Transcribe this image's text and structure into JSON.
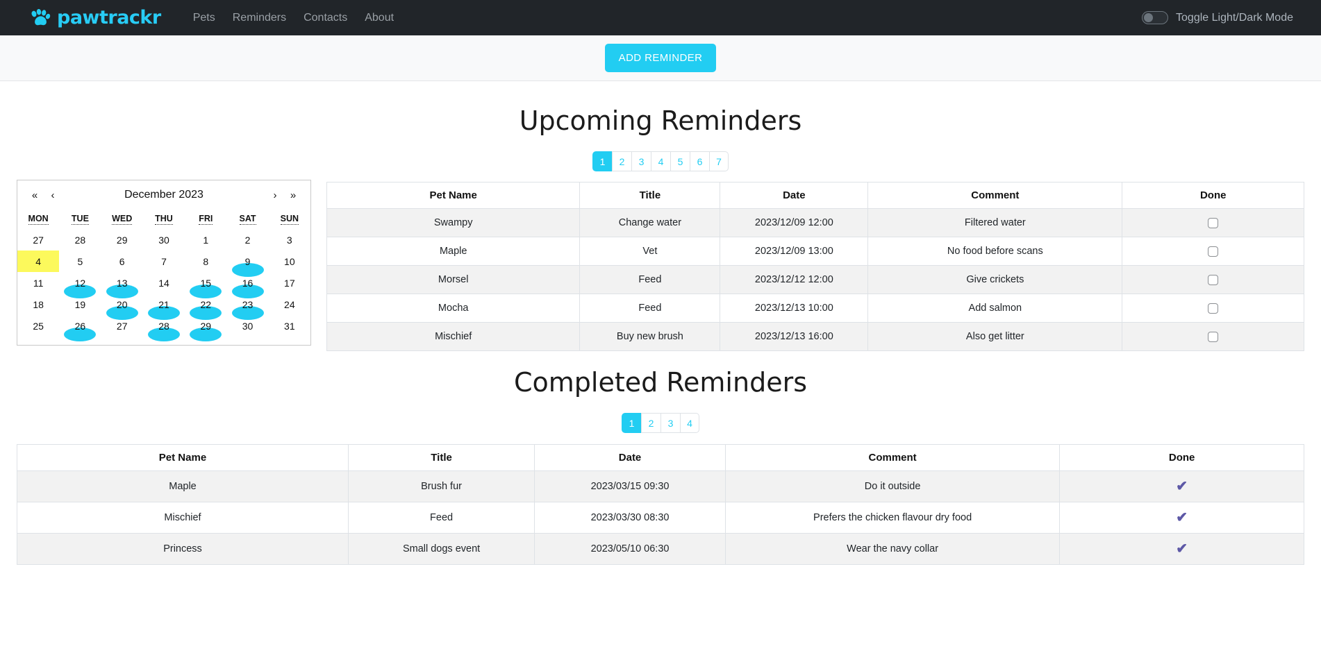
{
  "navbar": {
    "brand": "pawtrackr",
    "brand_icon": "paw-icon",
    "links": [
      {
        "label": "Pets"
      },
      {
        "label": "Reminders"
      },
      {
        "label": "Contacts"
      },
      {
        "label": "About"
      }
    ],
    "theme_toggle_label": "Toggle Light/Dark Mode",
    "theme_toggle_state": "off",
    "accent_color": "#22cdf2",
    "background_color": "#212529"
  },
  "actionbar": {
    "add_reminder_label": "ADD REMINDER"
  },
  "upcoming": {
    "title": "Upcoming Reminders",
    "pagination": {
      "pages": [
        "1",
        "2",
        "3",
        "4",
        "5",
        "6",
        "7"
      ],
      "active": "1"
    },
    "columns": [
      "Pet Name",
      "Title",
      "Date",
      "Comment",
      "Done"
    ],
    "rows": [
      {
        "pet": "Swampy",
        "title": "Change water",
        "date": "2023/12/09 12:00",
        "comment": "Filtered water",
        "done": false
      },
      {
        "pet": "Maple",
        "title": "Vet",
        "date": "2023/12/09 13:00",
        "comment": "No food before scans",
        "done": false
      },
      {
        "pet": "Morsel",
        "title": "Feed",
        "date": "2023/12/12 12:00",
        "comment": "Give crickets",
        "done": false
      },
      {
        "pet": "Mocha",
        "title": "Feed",
        "date": "2023/12/13 10:00",
        "comment": "Add salmon",
        "done": false
      },
      {
        "pet": "Mischief",
        "title": "Buy new brush",
        "date": "2023/12/13 16:00",
        "comment": "Also get litter",
        "done": false
      }
    ]
  },
  "completed": {
    "title": "Completed Reminders",
    "pagination": {
      "pages": [
        "1",
        "2",
        "3",
        "4"
      ],
      "active": "1"
    },
    "columns": [
      "Pet Name",
      "Title",
      "Date",
      "Comment",
      "Done"
    ],
    "done_glyph": "✔",
    "done_color": "#5d58a6",
    "rows": [
      {
        "pet": "Maple",
        "title": "Brush fur",
        "date": "2023/03/15 09:30",
        "comment": "Do it outside",
        "done": true
      },
      {
        "pet": "Mischief",
        "title": "Feed",
        "date": "2023/03/30 08:30",
        "comment": "Prefers the chicken flavour dry food",
        "done": true
      },
      {
        "pet": "Princess",
        "title": "Small dogs event",
        "date": "2023/05/10 06:30",
        "comment": "Wear the navy collar",
        "done": true
      }
    ]
  },
  "calendar": {
    "title": "December 2023",
    "nav": {
      "first": "«",
      "prev": "‹",
      "next": "›",
      "last": "»"
    },
    "day_headers": [
      "MON",
      "TUE",
      "WED",
      "THU",
      "FRI",
      "SAT",
      "SUN"
    ],
    "today": 4,
    "today_highlight_color": "#fcf95c",
    "event_color": "#22cdf2",
    "weeks": [
      [
        {
          "d": "27",
          "o": true
        },
        {
          "d": "28",
          "o": true
        },
        {
          "d": "29",
          "o": true
        },
        {
          "d": "30",
          "o": true
        },
        {
          "d": "1"
        },
        {
          "d": "2"
        },
        {
          "d": "3"
        }
      ],
      [
        {
          "d": "4",
          "today": true
        },
        {
          "d": "5"
        },
        {
          "d": "6"
        },
        {
          "d": "7"
        },
        {
          "d": "8"
        },
        {
          "d": "9",
          "ev": true
        },
        {
          "d": "10"
        }
      ],
      [
        {
          "d": "11"
        },
        {
          "d": "12",
          "ev": true
        },
        {
          "d": "13",
          "ev": true
        },
        {
          "d": "14"
        },
        {
          "d": "15",
          "ev": true
        },
        {
          "d": "16",
          "ev": true
        },
        {
          "d": "17"
        }
      ],
      [
        {
          "d": "18"
        },
        {
          "d": "19"
        },
        {
          "d": "20",
          "ev": true
        },
        {
          "d": "21",
          "ev": true
        },
        {
          "d": "22",
          "ev": true
        },
        {
          "d": "23",
          "ev": true
        },
        {
          "d": "24"
        }
      ],
      [
        {
          "d": "25"
        },
        {
          "d": "26",
          "ev": true
        },
        {
          "d": "27"
        },
        {
          "d": "28",
          "ev": true
        },
        {
          "d": "29",
          "ev": true
        },
        {
          "d": "30"
        },
        {
          "d": "31"
        }
      ]
    ]
  }
}
